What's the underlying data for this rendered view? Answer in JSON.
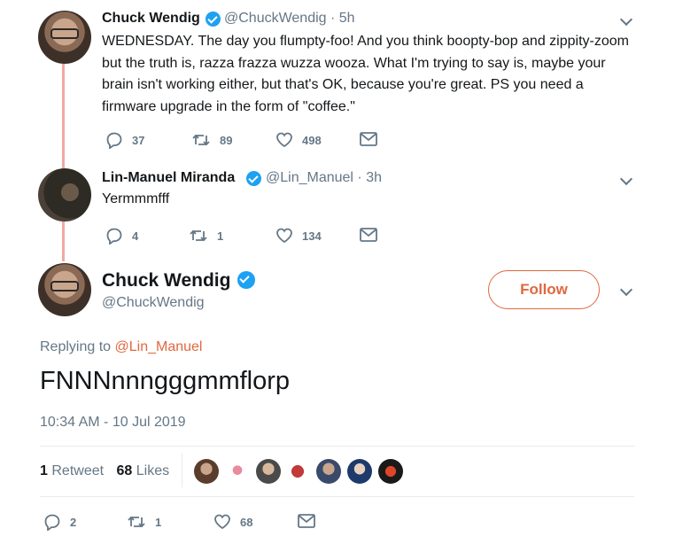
{
  "tweet1": {
    "name": "Chuck Wendig",
    "handle": "@ChuckWendig · 5h",
    "text": "WEDNESDAY. The day you flumpty-foo! And you think boopty-bop and zippity-zoom but the truth is, razza frazza wuzza wooza. What I'm trying to say is, maybe your brain isn't working either, but that's OK, because you're great. PS you need a firmware upgrade in the form of \"coffee.\"",
    "replies": "37",
    "retweets": "89",
    "likes": "498"
  },
  "tweet2": {
    "name": "Lin-Manuel Miranda",
    "handle": "@Lin_Manuel · 3h",
    "text": "Yermmmfff",
    "replies": "4",
    "retweets": "1",
    "likes": "134"
  },
  "main": {
    "name": "Chuck Wendig",
    "handle": "@ChuckWendig",
    "follow_label": "Follow",
    "replying_prefix": "Replying to ",
    "replying_handle": "@Lin_Manuel",
    "text": "FNNNnnngggmmflorp",
    "timestamp": "10:34 AM - 10 Jul 2019",
    "retweet_count": "1",
    "retweet_label": "Retweet",
    "like_count": "68",
    "like_label": "Likes",
    "replies": "2",
    "retweets": "1",
    "likes": "68"
  },
  "colors": {
    "accent": "#e0683f",
    "verified": "#1da1f2",
    "muted": "#657786",
    "thread_line": "#f0a9a0"
  }
}
